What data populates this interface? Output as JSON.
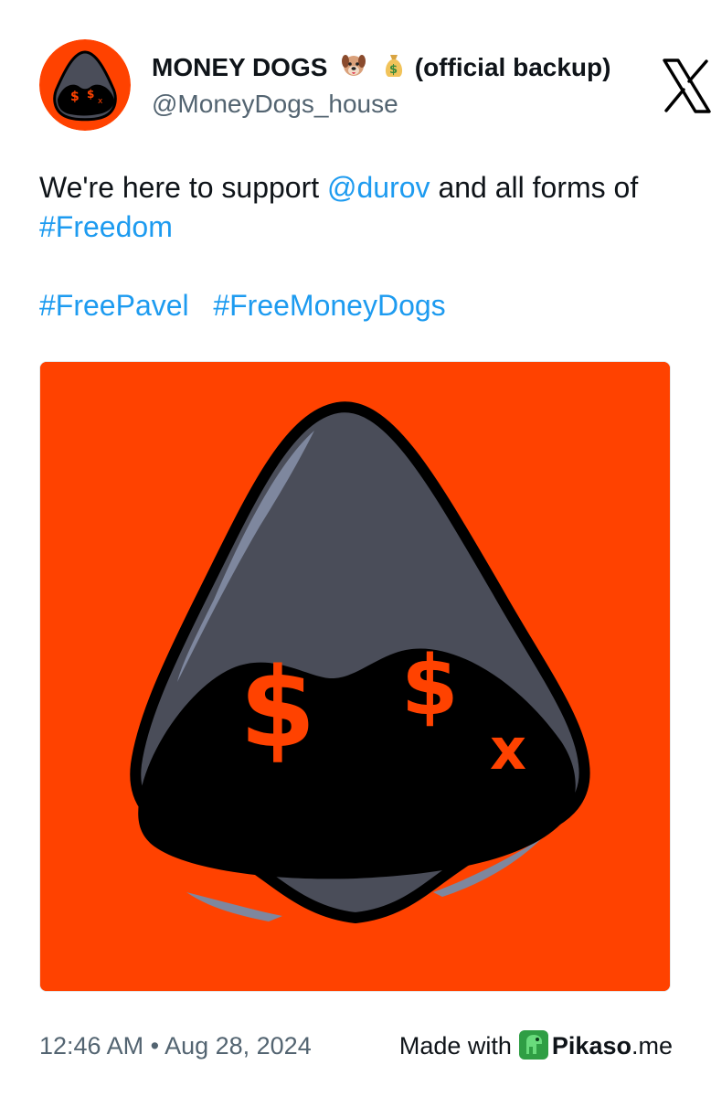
{
  "author": {
    "display_name": "MONEY DOGS",
    "name_suffix": "(official backup)",
    "emojis": [
      "dog-face-icon",
      "money-bag-icon"
    ],
    "handle": "@MoneyDogs_house"
  },
  "tweet": {
    "text_start": "We're here to support ",
    "mention": "@durov",
    "text_end": " and all forms of ",
    "hashtag_freedom": "#Freedom",
    "hashtag_1": "#FreePavel",
    "hashtag_2": "#FreeMoneyDogs"
  },
  "meta": {
    "time": "12:46 AM",
    "separator": "•",
    "date": "Aug 28, 2024"
  },
  "credit": {
    "made_with": "Made with",
    "brand_bold": "Pikaso",
    "brand_suffix": ".me"
  },
  "colors": {
    "link": "#1d9bf0",
    "media_background": "#ff4200",
    "hood": "#4a4d59",
    "muted_text": "#536471"
  },
  "icons": {
    "platform": "x-logo-icon",
    "credit": "pikaso-dino-icon"
  }
}
